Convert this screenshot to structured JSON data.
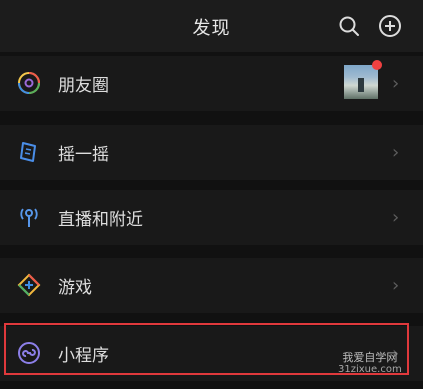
{
  "header": {
    "title": "发现",
    "icons": [
      "search-icon",
      "add-icon"
    ]
  },
  "rows": [
    {
      "label": "朋友圈",
      "icon": "moments-icon",
      "has_thumbnail": true,
      "has_red_dot": true
    },
    {
      "label": "摇一摇",
      "icon": "shake-icon"
    },
    {
      "label": "直播和附近",
      "icon": "live-nearby-icon"
    },
    {
      "label": "游戏",
      "icon": "game-icon"
    },
    {
      "label": "小程序",
      "icon": "mini-program-icon",
      "highlighted": true
    }
  ],
  "chevron": "›",
  "watermark": {
    "line1": "我爱自学网",
    "line2": "31zixue.com"
  },
  "colors": {
    "background": "#111111",
    "row": "#191919",
    "highlight": "#e0393c",
    "notification": "#f04141"
  }
}
